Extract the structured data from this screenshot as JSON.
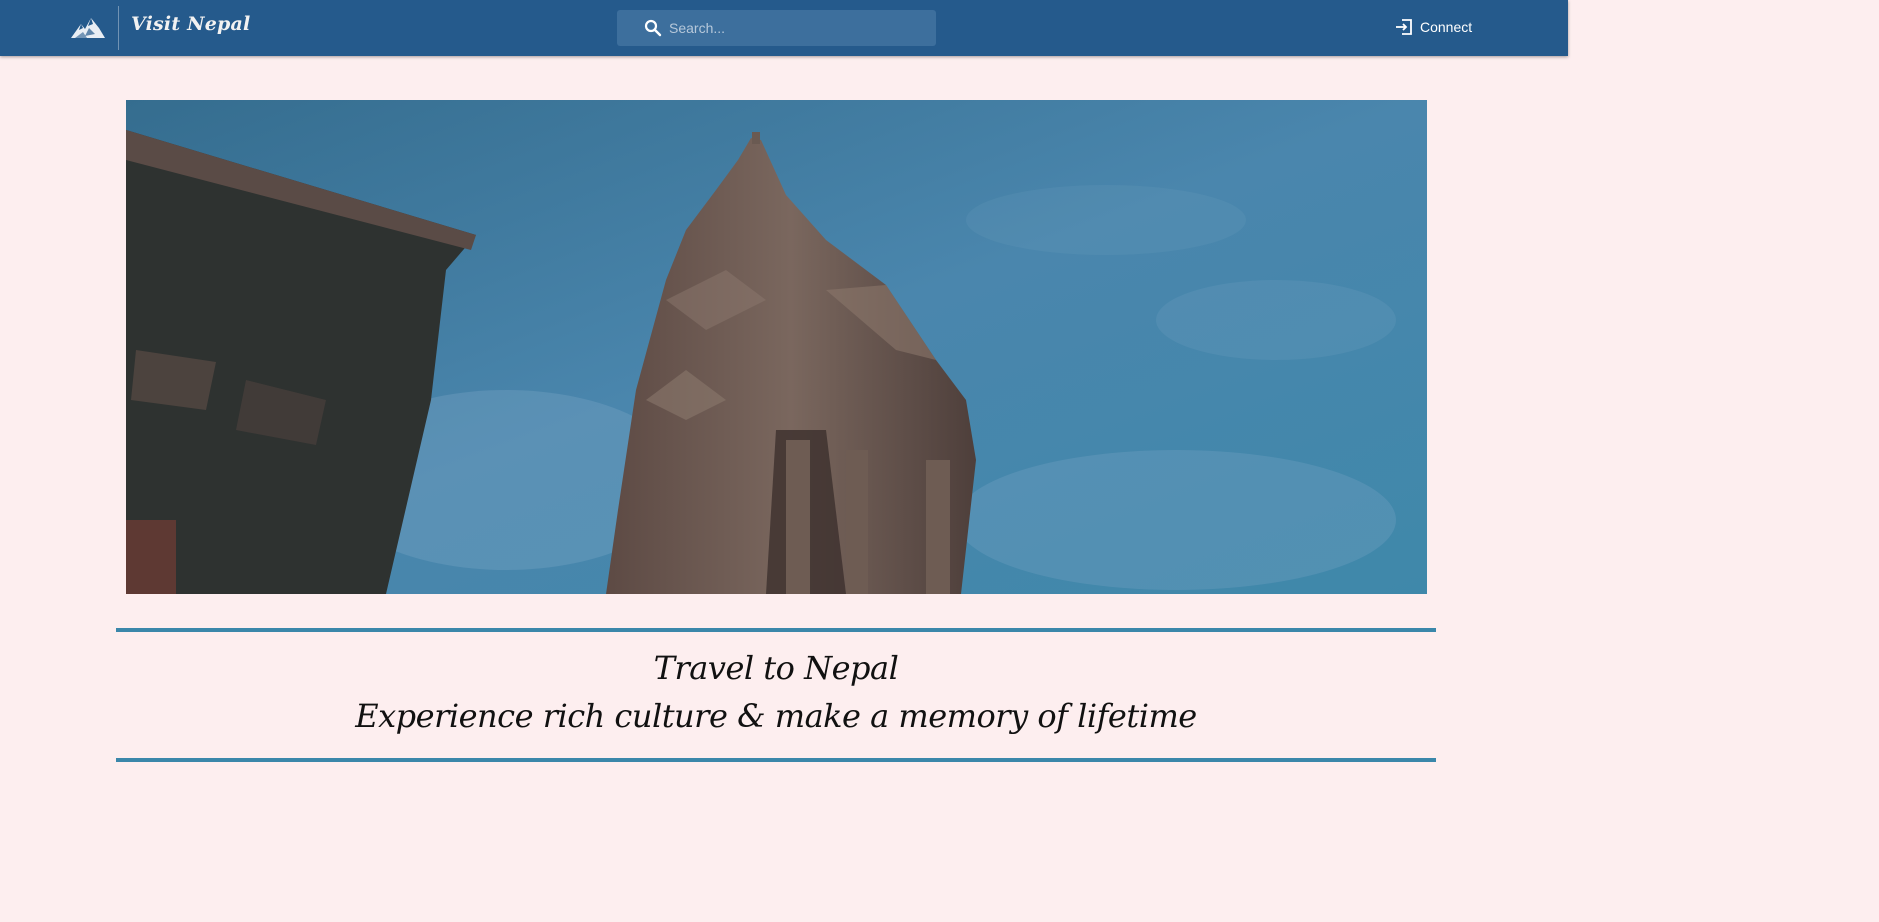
{
  "navbar": {
    "brand_name": "Visit Nepal",
    "logo_icon": "mountain-logo-icon",
    "search": {
      "placeholder": "Search...",
      "value": "",
      "icon": "search-icon"
    },
    "connect": {
      "label": "Connect",
      "icon": "login-icon"
    }
  },
  "hero": {
    "image": "temple-tower-photo"
  },
  "tagline": {
    "title": "Travel to Nepal",
    "subtitle": "Experience rich culture & make a memory of lifetime"
  },
  "colors": {
    "navbar": "#255a8c",
    "search_bg": "#3d6f9d",
    "page_bg": "#fdeeef",
    "accent_rule": "#3a87aa",
    "text": "#111111"
  }
}
